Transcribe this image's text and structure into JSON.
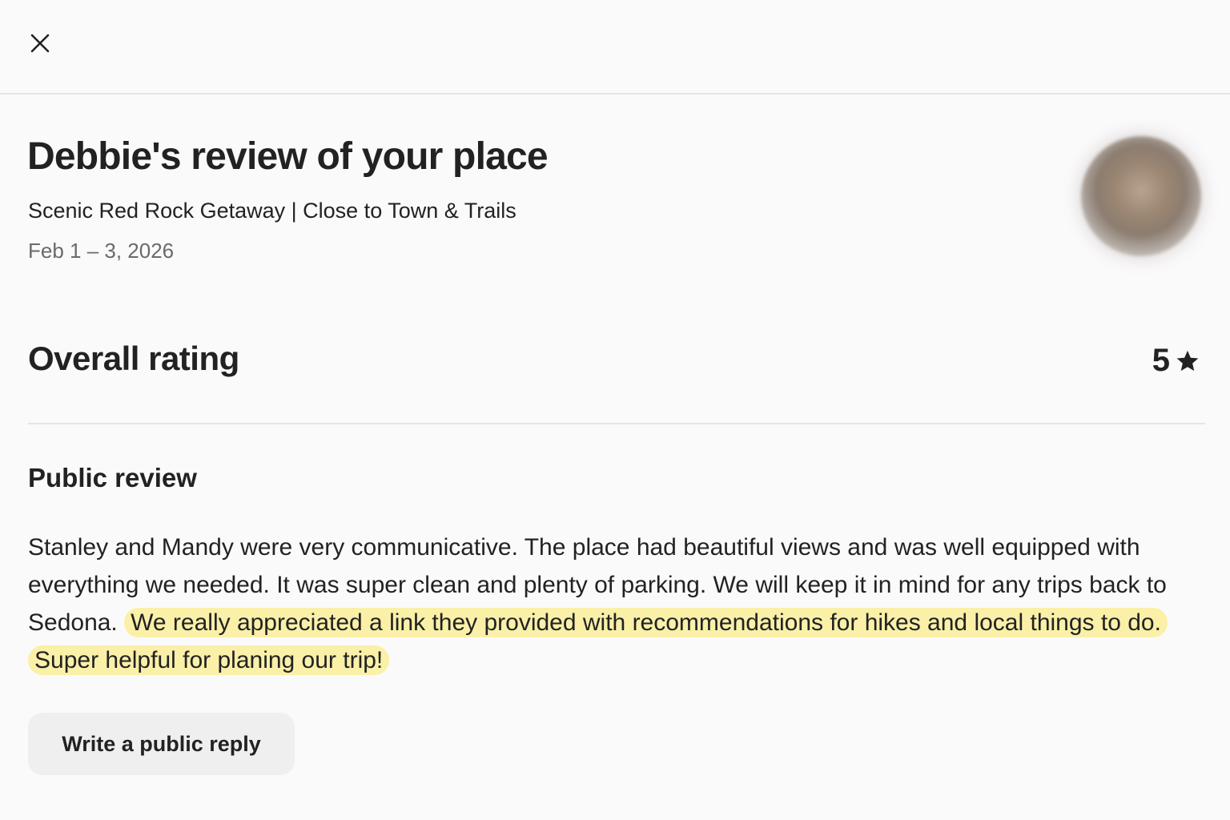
{
  "header": {
    "close_icon": "close-icon"
  },
  "review": {
    "title": "Debbie's review of your place",
    "listing_name": "Scenic Red Rock Getaway | Close to Town & Trails",
    "dates": "Feb 1 – 3, 2026",
    "avatar_icon": "avatar"
  },
  "rating": {
    "label": "Overall rating",
    "value": "5",
    "star_icon": "star-icon"
  },
  "public_review": {
    "heading": "Public review",
    "text_plain": "Stanley and Mandy were very communicative. The place had beautiful views and was well equipped with everything we needed. It was super clean and plenty of parking. We will keep it in mind for any trips back to Sedona.",
    "text_highlighted": "We really appreciated a link they provided with recommendations for hikes and local things to do. Super helpful for planing our trip!",
    "highlight_color": "#faf0a8"
  },
  "actions": {
    "reply_label": "Write a public reply"
  }
}
